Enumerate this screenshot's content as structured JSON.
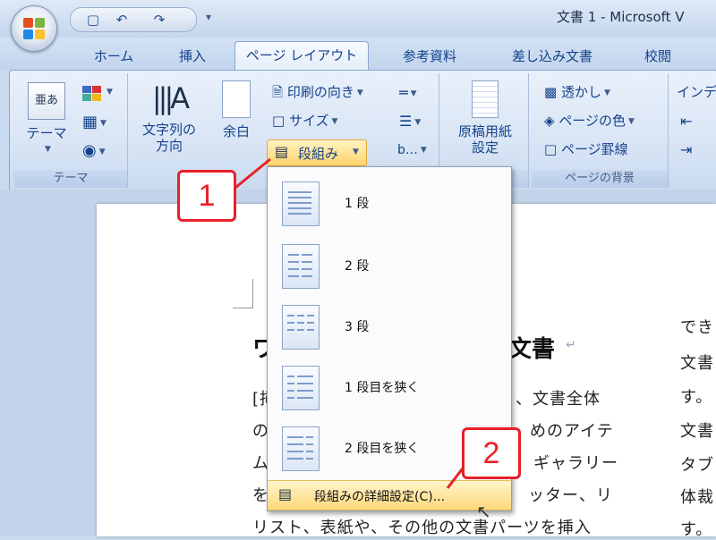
{
  "window": {
    "title": "文書 1 - Microsoft V"
  },
  "quick_access": {
    "icons": [
      "save-icon",
      "undo-icon",
      "redo-icon",
      "customize-icon"
    ]
  },
  "tabs": [
    "ホーム",
    "挿入",
    "ページ レイアウト",
    "参考資料",
    "差し込み文書",
    "校閲"
  ],
  "ribbon": {
    "theme_group": {
      "label": "テーマ",
      "theme_button": "テーマ",
      "theme_icon_text": "亜あ"
    },
    "page_setup_group": {
      "text_direction": [
        "文字列の",
        "方向"
      ],
      "margins": "余白",
      "orientation": "印刷の向き",
      "size": "サイズ",
      "columns": "段組み"
    },
    "manuscript_group": {
      "label": "原稿用紙",
      "button": [
        "原稿用紙",
        "設定"
      ]
    },
    "page_background_group": {
      "label": "ページの背景",
      "watermark": "透かし",
      "page_color": "ページの色",
      "page_borders": "ページ罫線"
    },
    "paragraph_group": {
      "label": "インデ"
    }
  },
  "columns_menu": {
    "items": [
      "1 段",
      "2 段",
      "3 段",
      "1 段目を狭く",
      "2 段目を狭く"
    ],
    "more": "段組みの詳細設定(C)..."
  },
  "document": {
    "title_left": "ワ",
    "title_right": "文書",
    "lines": [
      "[挿",
      "の",
      "ム",
      "を",
      "リスト、表紙や、その他の文書パーツを挿入"
    ],
    "right_fragments": [
      "、文書全体",
      "めのアイテ",
      "ギャラリー",
      "ッター、リ"
    ],
    "side_column": [
      "でき",
      "文書",
      "す。",
      "文書",
      "タブ",
      "体裁",
      "す。"
    ]
  },
  "callouts": [
    "1",
    "2"
  ],
  "colors": {
    "ribbon_blue": "#15428b",
    "highlight": "#ffd36b",
    "callout_red": "#e8202a"
  }
}
